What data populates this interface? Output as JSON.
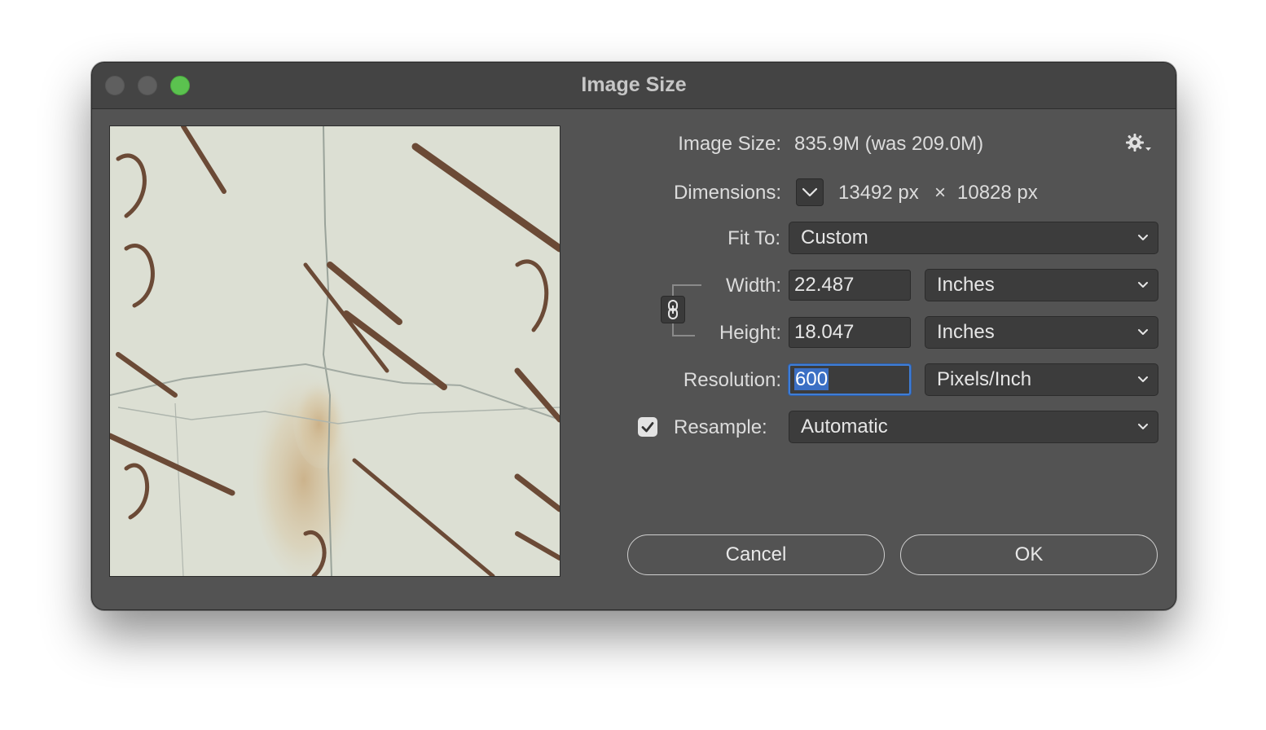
{
  "window": {
    "title": "Image Size"
  },
  "info": {
    "image_size_label": "Image Size:",
    "image_size_value": "835.9M (was 209.0M)",
    "dimensions_label": "Dimensions:",
    "dimensions_width": "13492 px",
    "dimensions_sep": "×",
    "dimensions_height": "10828 px"
  },
  "fit_to": {
    "label": "Fit To:",
    "value": "Custom"
  },
  "width": {
    "label": "Width:",
    "value": "22.487",
    "unit": "Inches"
  },
  "height": {
    "label": "Height:",
    "value": "18.047",
    "unit": "Inches"
  },
  "resolution": {
    "label": "Resolution:",
    "value": "600",
    "unit": "Pixels/Inch"
  },
  "resample": {
    "label": "Resample:",
    "checked": true,
    "value": "Automatic"
  },
  "buttons": {
    "cancel": "Cancel",
    "ok": "OK"
  },
  "colors": {
    "window_bg": "#535353",
    "titlebar_bg": "#444444",
    "field_bg": "#3c3c3c",
    "focus_ring": "#3f7dd6",
    "zoom_button": "#5bc24f"
  },
  "icons": {
    "gear": "gear-icon",
    "chain": "link-chain-icon",
    "chevron": "chevron-down-icon",
    "check": "checkmark-icon"
  }
}
